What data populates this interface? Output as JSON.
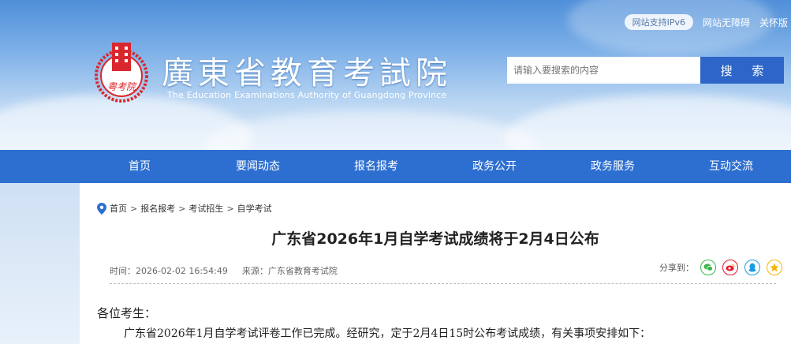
{
  "top": {
    "ipv6": "网站支持IPv6",
    "accessible": "网站无障碍",
    "care": "关怀版"
  },
  "site": {
    "title": "廣東省教育考試院",
    "subtitle": "The Education Examinations Authority of Guangdong Province",
    "logo_text": "粤考院"
  },
  "search": {
    "placeholder": "请输入要搜索的内容",
    "button": "搜 索"
  },
  "nav": [
    "首页",
    "要闻动态",
    "报名报考",
    "政务公开",
    "政务服务",
    "互动交流"
  ],
  "breadcrumb": [
    "首页",
    "报名报考",
    "考试招生",
    "自学考试"
  ],
  "article": {
    "title": "广东省2026年1月自学考试成绩将于2月4日公布",
    "time": "时间：2026-02-02 16:54:49",
    "source": "来源：广东省教育考试院",
    "share_label": "分享到：",
    "greeting": "各位考生：",
    "paragraph": "广东省2026年1月自学考试评卷工作已完成。经研究，定于2月4日15时公布考试成绩，有关事项安排如下："
  },
  "colors": {
    "nav": "#2d6fd1",
    "search_button": "#2d66c8",
    "logo_red": "#d9272e"
  }
}
